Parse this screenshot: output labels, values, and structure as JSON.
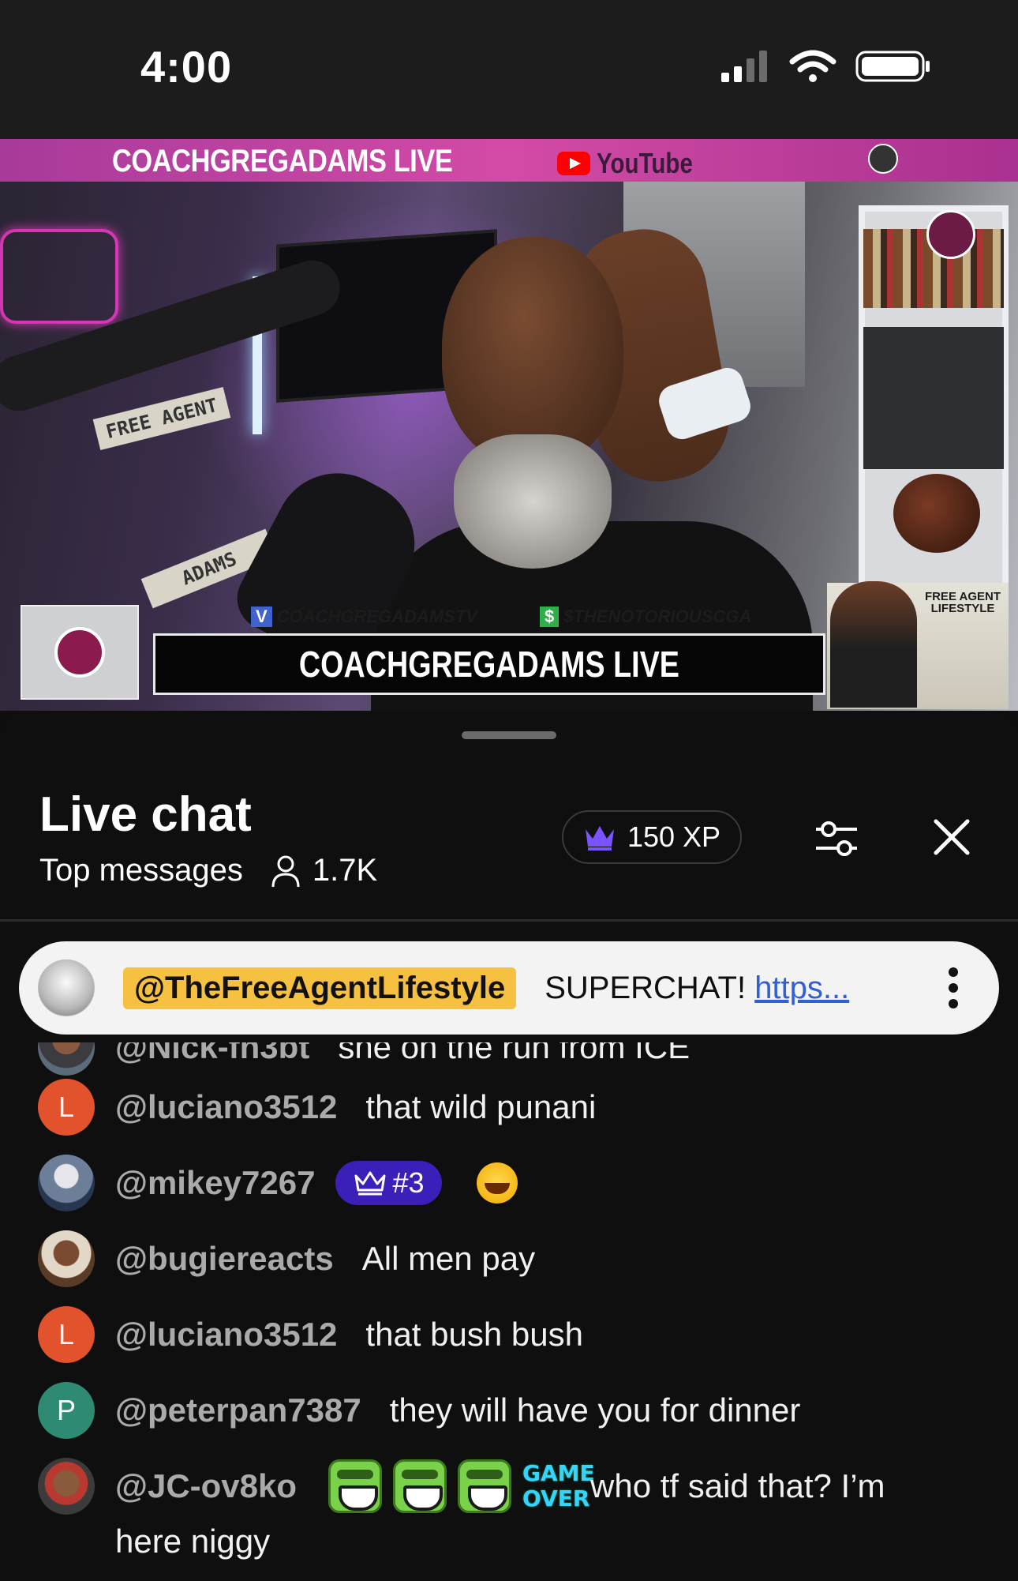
{
  "status_bar": {
    "time": "4:00",
    "icons": [
      "signal-icon",
      "wifi-icon",
      "battery-icon"
    ]
  },
  "video": {
    "top_banner_title": "COACHGREGADAMS LIVE",
    "platform": "YouTube",
    "lower_third_title": "COACHGREGADAMS LIVE",
    "handle_left_tag": "V",
    "handle_left": "COACHGREGADAMSTV",
    "handle_right_tag": "$",
    "handle_right": "$THENOTORIOUSCGA",
    "plaque_1": "FREE AGENT",
    "plaque_2": "ADAMS",
    "promo_text": "FREE AGENT LIFESTYLE"
  },
  "chat": {
    "title": "Live chat",
    "mode": "Top messages",
    "viewer_count": "1.7K",
    "xp": "150 XP",
    "pinned": {
      "handle": "@TheFreeAgentLifestyle",
      "message_prefix": "SUPERCHAT!",
      "message_link": "https..."
    },
    "messages": [
      {
        "handle": "@Nick-fn3bt",
        "text": "she on the run from ICE",
        "avatar_letter": ""
      },
      {
        "handle": "@luciano3512",
        "text": "that wild punani",
        "avatar_letter": "L"
      },
      {
        "handle": "@mikey7267",
        "badge": "#3",
        "text": "",
        "avatar_letter": ""
      },
      {
        "handle": "@bugiereacts",
        "text": "All men pay",
        "avatar_letter": ""
      },
      {
        "handle": "@luciano3512",
        "text": "that bush bush",
        "avatar_letter": "L"
      },
      {
        "handle": "@peterpan7387",
        "text": "they will have you for dinner",
        "avatar_letter": "P"
      },
      {
        "handle": "@JC-ov8ko",
        "emote_text": "GAME OVER",
        "text": "who tf said that? I’m",
        "text_cont": "here niggy",
        "avatar_letter": ""
      }
    ]
  },
  "colors": {
    "accent_purple": "#3b1fb8",
    "pinned_handle_bg": "#f6c141",
    "link": "#3160d3",
    "avatar_orange": "#e2522c",
    "avatar_teal": "#2f8a73"
  }
}
